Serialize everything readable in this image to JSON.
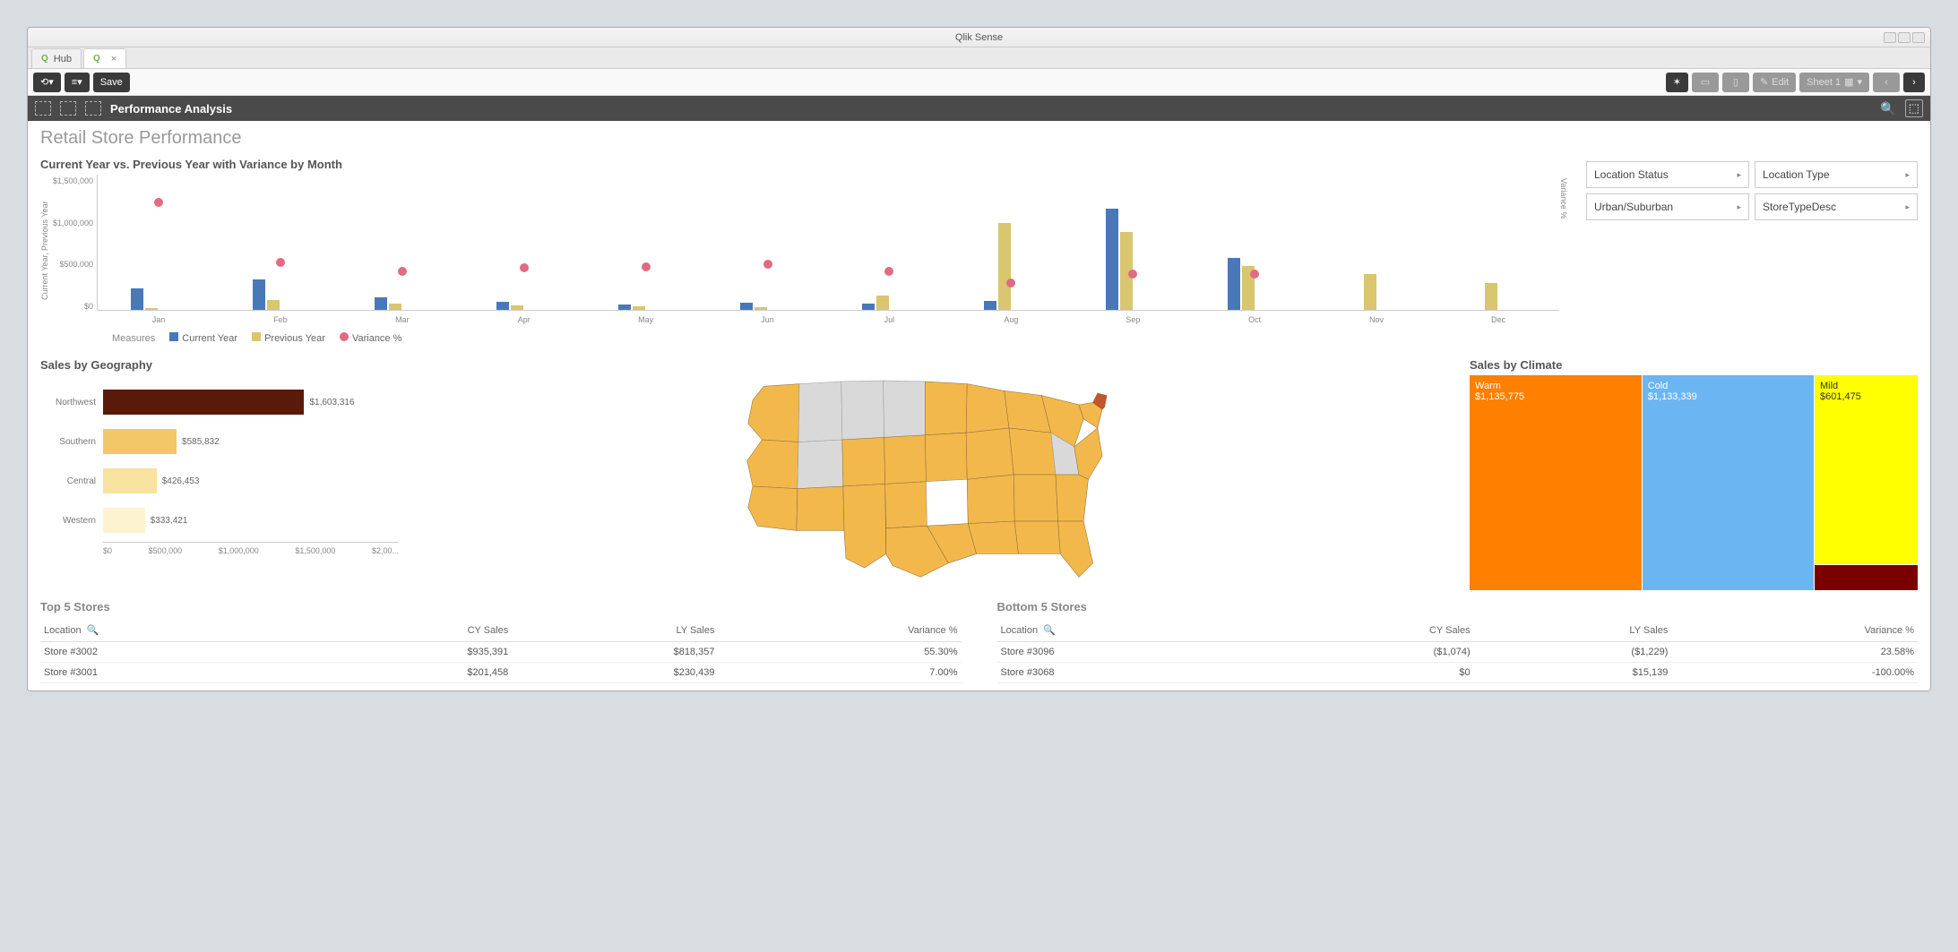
{
  "app": {
    "title": "Qlik Sense"
  },
  "tabs": [
    {
      "label": "Hub"
    },
    {
      "label": ""
    }
  ],
  "toolbar": {
    "save": "Save",
    "edit": "Edit",
    "sheet": "Sheet 1"
  },
  "subheader": {
    "title": "Performance Analysis"
  },
  "page": {
    "title": "Retail Store Performance"
  },
  "filters": [
    {
      "label": "Location Status"
    },
    {
      "label": "Location Type"
    },
    {
      "label": "Urban/Suburban"
    },
    {
      "label": "StoreTypeDesc"
    }
  ],
  "legend": {
    "title": "Measures",
    "cy": "Current Year",
    "py": "Previous Year",
    "var": "Variance %"
  },
  "chart_data": [
    {
      "id": "monthly",
      "type": "bar",
      "title": "Current Year vs. Previous Year with Variance by Month",
      "ylabel": "Current Year, Previous Year",
      "y2label": "Variance %",
      "categories": [
        "Jan",
        "Feb",
        "Mar",
        "Apr",
        "May",
        "Jun",
        "Jul",
        "Aug",
        "Sep",
        "Oct",
        "Nov",
        "Dec"
      ],
      "ylim": [
        0,
        1500000
      ],
      "yticks": [
        "$1,500,000",
        "$1,000,000",
        "$500,000",
        "$0"
      ],
      "series": [
        {
          "name": "Current Year",
          "color": "#4878b8",
          "values": [
            240000,
            340000,
            140000,
            90000,
            60000,
            80000,
            70000,
            100000,
            1130000,
            580000,
            0,
            0
          ]
        },
        {
          "name": "Previous Year",
          "color": "#d9c66f",
          "values": [
            20000,
            110000,
            70000,
            50000,
            40000,
            30000,
            160000,
            970000,
            870000,
            490000,
            400000,
            300000
          ]
        },
        {
          "name": "Variance %",
          "color": "#e06b82",
          "type": "scatter",
          "values": [
            1200,
            530,
            430,
            470,
            480,
            510,
            430,
            300,
            400,
            400,
            null,
            null
          ]
        }
      ]
    },
    {
      "id": "geography",
      "type": "bar",
      "orientation": "horizontal",
      "title": "Sales by Geography",
      "categories": [
        "Northwest",
        "Southern",
        "Central",
        "Western"
      ],
      "values": [
        1603316,
        585832,
        426453,
        333421
      ],
      "value_labels": [
        "$1,603,316",
        "$585,832",
        "$426,453",
        "$333,421"
      ],
      "colors": [
        "#5a1a0a",
        "#f3c768",
        "#f8e2a0",
        "#fdf3d1"
      ],
      "xlim": [
        0,
        2000000
      ],
      "xticks": [
        "$0",
        "$500,000",
        "$1,000,000",
        "$1,500,000",
        "$2,00..."
      ]
    },
    {
      "id": "climate",
      "type": "treemap",
      "title": "Sales by Climate",
      "items": [
        {
          "label": "Warm",
          "value": "$1,135,775",
          "num": 1135775,
          "color": "#ff7f00"
        },
        {
          "label": "Cold",
          "value": "$1,133,339",
          "num": 1133339,
          "color": "#6bb5f2"
        },
        {
          "label": "Mild",
          "value": "$601,475",
          "num": 601475,
          "color": "#ffff00"
        },
        {
          "label": "",
          "value": "",
          "num": 80000,
          "color": "#7a0000"
        }
      ]
    }
  ],
  "top5": {
    "title": "Top 5 Stores",
    "columns": [
      "Location",
      "CY Sales",
      "LY Sales",
      "Variance %"
    ],
    "rows": [
      [
        "Store #3002",
        "$935,391",
        "$818,357",
        "55.30%"
      ],
      [
        "Store #3001",
        "$201,458",
        "$230,439",
        "7.00%"
      ]
    ]
  },
  "bottom5": {
    "title": "Bottom 5 Stores",
    "columns": [
      "Location",
      "CY Sales",
      "LY Sales",
      "Variance %"
    ],
    "rows": [
      [
        "Store #3096",
        "($1,074)",
        "($1,229)",
        "23.58%"
      ],
      [
        "Store #3068",
        "$0",
        "$15,139",
        "-100.00%"
      ]
    ]
  }
}
